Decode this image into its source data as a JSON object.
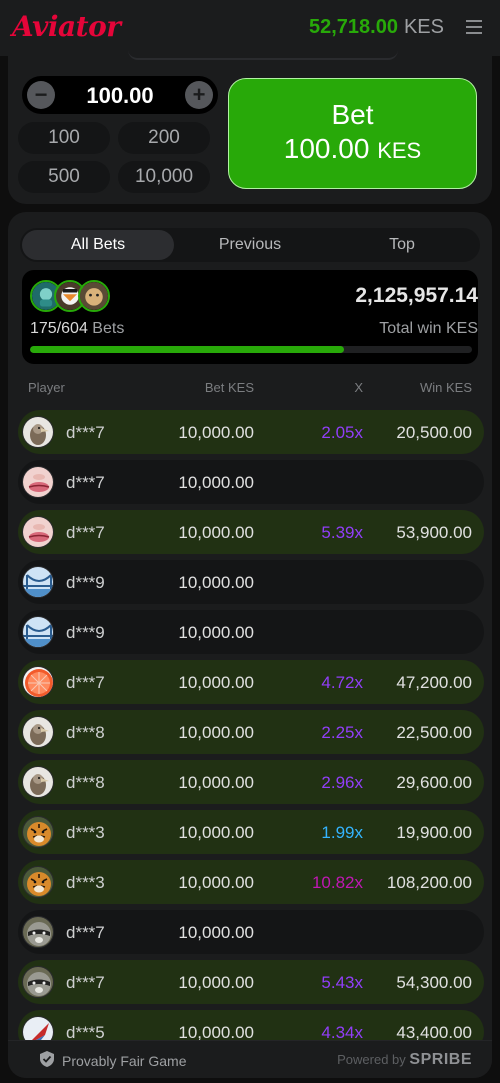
{
  "header": {
    "logo": "Aviator",
    "balance": "52,718.00",
    "currency": "KES",
    "menu_icon": "hamburger-menu-icon"
  },
  "bet_panel": {
    "amount": "100.00",
    "minus_label": "−",
    "plus_label": "+",
    "quick_amounts": [
      "100",
      "200",
      "500",
      "10,000"
    ],
    "bet_button": {
      "label": "Bet",
      "amount": "100.00",
      "currency": "KES"
    }
  },
  "bets": {
    "tabs": [
      {
        "label": "All Bets",
        "active": true
      },
      {
        "label": "Previous",
        "active": false
      },
      {
        "label": "Top",
        "active": false
      }
    ],
    "summary": {
      "count": "175/604",
      "count_label": "Bets",
      "total": "2,125,957.14",
      "total_label": "Total win KES",
      "progress_fraction": 0.71
    },
    "columns": {
      "player": "Player",
      "bet": "Bet KES",
      "x": "X",
      "win": "Win KES"
    },
    "rows": [
      {
        "player": "d***7",
        "bet": "10,000.00",
        "mult": "2.05x",
        "win": "20,500.00",
        "won": true,
        "mult_color": "#913ef8",
        "avatar": "vulture"
      },
      {
        "player": "d***7",
        "bet": "10,000.00",
        "mult": "",
        "win": "",
        "won": false,
        "mult_color": "",
        "avatar": "lips"
      },
      {
        "player": "d***7",
        "bet": "10,000.00",
        "mult": "5.39x",
        "win": "53,900.00",
        "won": true,
        "mult_color": "#913ef8",
        "avatar": "lips"
      },
      {
        "player": "d***9",
        "bet": "10,000.00",
        "mult": "",
        "win": "",
        "won": false,
        "mult_color": "",
        "avatar": "bridge"
      },
      {
        "player": "d***9",
        "bet": "10,000.00",
        "mult": "",
        "win": "",
        "won": false,
        "mult_color": "",
        "avatar": "bridge"
      },
      {
        "player": "d***7",
        "bet": "10,000.00",
        "mult": "4.72x",
        "win": "47,200.00",
        "won": true,
        "mult_color": "#913ef8",
        "avatar": "grapefruit"
      },
      {
        "player": "d***8",
        "bet": "10,000.00",
        "mult": "2.25x",
        "win": "22,500.00",
        "won": true,
        "mult_color": "#913ef8",
        "avatar": "vulture"
      },
      {
        "player": "d***8",
        "bet": "10,000.00",
        "mult": "2.96x",
        "win": "29,600.00",
        "won": true,
        "mult_color": "#913ef8",
        "avatar": "vulture"
      },
      {
        "player": "d***3",
        "bet": "10,000.00",
        "mult": "1.99x",
        "win": "19,900.00",
        "won": true,
        "mult_color": "#34b4ff",
        "avatar": "tiger"
      },
      {
        "player": "d***3",
        "bet": "10,000.00",
        "mult": "10.82x",
        "win": "108,200.00",
        "won": true,
        "mult_color": "#c017b4",
        "avatar": "tiger"
      },
      {
        "player": "d***7",
        "bet": "10,000.00",
        "mult": "",
        "win": "",
        "won": false,
        "mult_color": "",
        "avatar": "raccoon"
      },
      {
        "player": "d***7",
        "bet": "10,000.00",
        "mult": "5.43x",
        "win": "54,300.00",
        "won": true,
        "mult_color": "#913ef8",
        "avatar": "raccoon"
      },
      {
        "player": "d***5",
        "bet": "10,000.00",
        "mult": "4.34x",
        "win": "43,400.00",
        "won": true,
        "mult_color": "#913ef8",
        "avatar": "bird"
      }
    ]
  },
  "footer": {
    "left_text": "Provably Fair Game",
    "right_text": "Powered by",
    "brand": "SPRIBE"
  },
  "colors": {
    "accent_green": "#28a909",
    "logo_red": "#e50539",
    "win_row_bg": "#213113"
  }
}
